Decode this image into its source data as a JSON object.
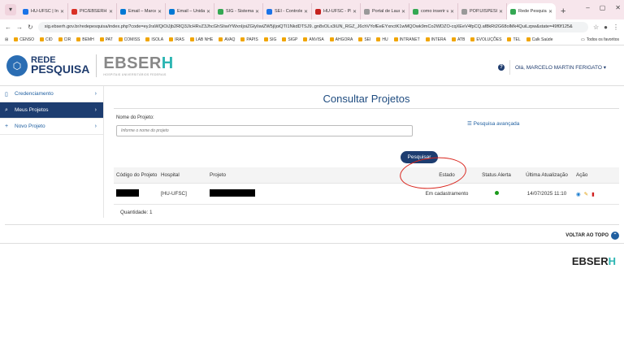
{
  "browser": {
    "tabs": [
      {
        "title": "HU-UFSC | Intr",
        "color": "#1a73e8"
      },
      {
        "title": "PIC/EBSERH -",
        "color": "#d93025"
      },
      {
        "title": "Email – Marcel",
        "color": "#0078d4"
      },
      {
        "title": "Email – Unida",
        "color": "#0078d4"
      },
      {
        "title": "SIG - Sistema",
        "color": "#34a853"
      },
      {
        "title": "SEI - Controle",
        "color": "#1a73e8"
      },
      {
        "title": "HU-UFSC - PIC",
        "color": "#c5221f"
      },
      {
        "title": "Portal de Laud",
        "color": "#999999"
      },
      {
        "title": "como inserir u",
        "color": "#34a853"
      },
      {
        "title": "POP.UISPESQ",
        "color": "#999999"
      },
      {
        "title": "Rede Pesquisa",
        "color": "#34a853"
      }
    ],
    "new_tab": "+",
    "url": "sig.ebserh.gov.br/redepesquisa/index.php?code=eyJraWQiOiJjb2RlQ3JlcHRvZ3JhcGhSIiwiYWxnIjoiZGlyIiwiZW5jIjoiQTI1NkdDTSJ9..gn8xOLx3iUN_RGZ_J6chVYofEeEYxnctK1wMQOwk9mCo2WDZO-cqXEeV4fpCQ.af8kRt2G68olMk4QuiLzpw&state=49f0f125&",
    "bookmarks": [
      "CENSO",
      "CID",
      "CIR",
      "BEMH",
      "PAT",
      "COMISS",
      "ISOLA",
      "IRAS",
      "LAB NHE",
      "AVAQ",
      "PAPIS",
      "SIG",
      "SIGP",
      "ANVISA",
      "AHGORA",
      "SEI",
      "HU",
      "INTRANET",
      "INTERA",
      "ATB",
      "EVOLUÇÕES",
      "TEL",
      "Calk Saúde"
    ],
    "bookmarks_right": "Todos os favoritos"
  },
  "header": {
    "logo_line1": "REDE",
    "logo_line2": "PESQUISA",
    "ebserh_main": "EBSER",
    "ebserh_h": "H",
    "ebserh_sub": "HOSPITAIS UNIVERSITÁRIOS FEDERAIS",
    "help": "?",
    "user_greeting": "Olá, MARCELO MARTIN FERIGATO ▾"
  },
  "sidebar": {
    "items": [
      {
        "label": "Credenciamento",
        "icon": "▯"
      },
      {
        "label": "Meus Projetos",
        "icon": "⌕"
      },
      {
        "label": "Novo Projeto",
        "icon": "+"
      }
    ]
  },
  "main": {
    "title": "Consultar Projetos",
    "field_label": "Nome do Projeto:",
    "field_placeholder": "Informe o nome do projeto",
    "advanced": "☰ Pesquisa avançada",
    "search_button": "Pesquisar",
    "columns": [
      "Código do Projeto",
      "Hospital",
      "Projeto",
      "Estado",
      "Status Alerta",
      "Última Atualização",
      "Ação"
    ],
    "rows": [
      {
        "hospital": "[HU-UFSC]",
        "estado": "Em cadastramento",
        "atualizacao": "14/07/2025 11:10"
      }
    ],
    "quantity": "Quantidade: 1"
  },
  "footer": {
    "back_to_top": "VOLTAR AO TOPO",
    "logo": "EBSER",
    "logo_h": "H"
  }
}
